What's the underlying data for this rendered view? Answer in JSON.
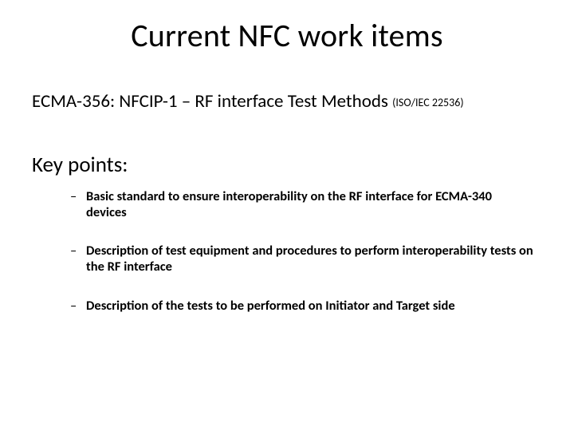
{
  "title": "Current NFC work items",
  "subtitle_main": "ECMA-356: NFCIP-1 – RF interface Test Methods ",
  "subtitle_suffix": "(ISO/IEC 22536)",
  "section_heading": "Key points:",
  "bullets": {
    "b0": "Basic standard to ensure interoperability on the RF interface for ECMA-340 devices",
    "b1": "Description of test equipment and procedures to perform interoperability tests on the RF interface",
    "b2": "Description of the tests to be performed on Initiator and Target side"
  }
}
